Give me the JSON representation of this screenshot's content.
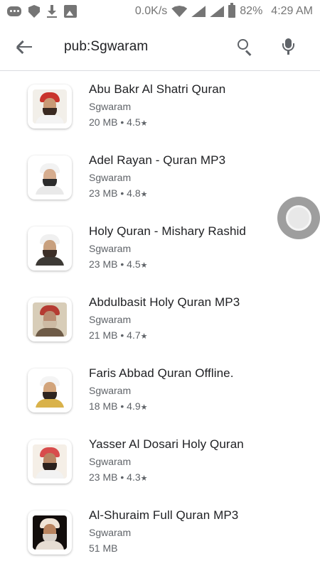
{
  "status_bar": {
    "speed": "0.0K/s",
    "battery": "82%",
    "time": "4:29 AM",
    "icons": [
      "message-icon",
      "shield-icon",
      "download-icon",
      "image-icon",
      "wifi-icon",
      "signal-icon",
      "battery-icon"
    ]
  },
  "search": {
    "query": "pub:Sgwaram"
  },
  "apps": [
    {
      "title": "Abu Bakr Al Shatri Quran",
      "developer": "Sgwaram",
      "size": "20 MB",
      "rating": "4.5",
      "colors": {
        "bg": "#f2efe9",
        "head": "#c9342c",
        "face": "#c99a76",
        "beard": "#3a2a22",
        "body": "#f4f4f4"
      }
    },
    {
      "title": "Adel Rayan - Quran MP3",
      "developer": "Sgwaram",
      "size": "23 MB",
      "rating": "4.8",
      "colors": {
        "bg": "#ffffff",
        "head": "#f2f2f2",
        "face": "#d6ad8f",
        "beard": "#2b2b2b",
        "body": "#e9e9e9"
      }
    },
    {
      "title": "Holy Quran - Mishary Rashid",
      "developer": "Sgwaram",
      "size": "23 MB",
      "rating": "4.5",
      "colors": {
        "bg": "#ffffff",
        "head": "#f0f0f0",
        "face": "#c8a07e",
        "beard": "#3c2f28",
        "body": "#3d3a36"
      }
    },
    {
      "title": "Abdulbasit Holy Quran MP3",
      "developer": "Sgwaram",
      "size": "21 MB",
      "rating": "4.7",
      "colors": {
        "bg": "#d8cdb8",
        "head": "#b53b32",
        "face": "#b98d72",
        "beard": "#cdbba4",
        "body": "#6e5b47"
      }
    },
    {
      "title": "Faris Abbad Quran Offline.",
      "developer": "Sgwaram",
      "size": "18 MB",
      "rating": "4.9",
      "colors": {
        "bg": "#ffffff",
        "head": "#f4f4f4",
        "face": "#d2a47b",
        "beard": "#2d2420",
        "body": "#d9b24a"
      }
    },
    {
      "title": "Yasser Al Dosari Holy Quran",
      "developer": "Sgwaram",
      "size": "23 MB",
      "rating": "4.3",
      "colors": {
        "bg": "#f5efe7",
        "head": "#d84c4c",
        "face": "#b78563",
        "beard": "#2a201b",
        "body": "#f2f2f2"
      }
    },
    {
      "title": "Al-Shuraim Full Quran MP3",
      "developer": "Sgwaram",
      "size": "51 MB",
      "rating": "",
      "colors": {
        "bg": "#120d0b",
        "head": "#f0e4d6",
        "face": "#b8835e",
        "beard": "#d8d0c8",
        "body": "#e6ddd3"
      }
    }
  ]
}
